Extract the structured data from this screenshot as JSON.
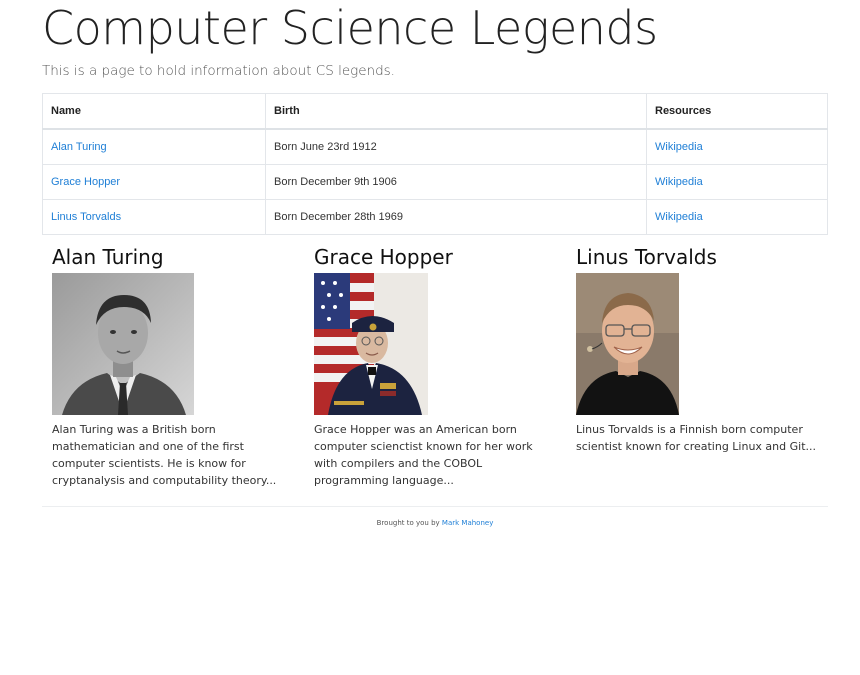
{
  "page": {
    "title": "Computer Science Legends",
    "lead": "This is a page to hold information about CS legends."
  },
  "table": {
    "headers": [
      "Name",
      "Birth",
      "Resources"
    ],
    "rows": [
      {
        "name": "Alan Turing",
        "birth": "Born June 23rd 1912",
        "resource": "Wikipedia"
      },
      {
        "name": "Grace Hopper",
        "birth": "Born December 9th 1906",
        "resource": "Wikipedia"
      },
      {
        "name": "Linus Torvalds",
        "birth": "Born December 28th 1969",
        "resource": "Wikipedia"
      }
    ]
  },
  "cards": [
    {
      "heading": "Alan Turing",
      "text": "Alan Turing was a British born mathematician and one of the first computer scientists. He is know for cryptanalysis and computability theory..."
    },
    {
      "heading": "Grace Hopper",
      "text": "Grace Hopper was an American born computer scienctist known for her work with compilers and the COBOL programming language..."
    },
    {
      "heading": "Linus Torvalds",
      "text": "Linus Torvalds is a Finnish born computer scientist known for creating Linux and Git..."
    }
  ],
  "footer": {
    "prefix": "Brought to you by",
    "author": "Mark Mahoney"
  },
  "colors": {
    "link": "#1f7fd6",
    "border": "#e3e6ea"
  }
}
